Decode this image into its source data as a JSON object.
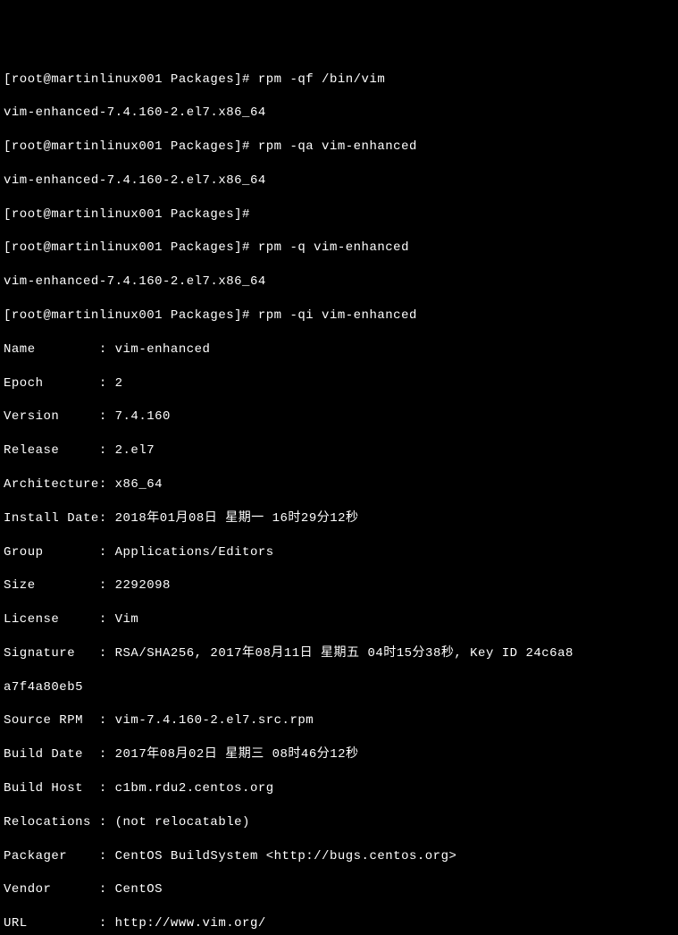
{
  "lines": {
    "l0_prompt": "[root@martinlinux001 Packages]# rpm -qf /bin/vim",
    "l1": "vim-enhanced-7.4.160-2.el7.x86_64",
    "l2_prompt": "[root@martinlinux001 Packages]# rpm -qa vim-enhanced",
    "l3": "vim-enhanced-7.4.160-2.el7.x86_64",
    "l4_prompt": "[root@martinlinux001 Packages]#",
    "l5_prompt": "[root@martinlinux001 Packages]# rpm -q vim-enhanced",
    "l6": "vim-enhanced-7.4.160-2.el7.x86_64",
    "l7_prompt": "[root@martinlinux001 Packages]# rpm -qi vim-enhanced",
    "f_name": "Name        : vim-enhanced",
    "f_epoch": "Epoch       : 2",
    "f_version": "Version     : 7.4.160",
    "f_release": "Release     : 2.el7",
    "f_arch": "Architecture: x86_64",
    "f_install": "Install Date: 2018年01月08日 星期一 16时29分12秒",
    "f_group": "Group       : Applications/Editors",
    "f_size": "Size        : 2292098",
    "f_license": "License     : Vim",
    "f_sig": "Signature   : RSA/SHA256, 2017年08月11日 星期五 04时15分38秒, Key ID 24c6a8",
    "f_sig2": "a7f4a80eb5",
    "f_srpm": "Source RPM  : vim-7.4.160-2.el7.src.rpm",
    "f_bdate": "Build Date  : 2017年08月02日 星期三 08时46分12秒",
    "f_bhost": "Build Host  : c1bm.rdu2.centos.org",
    "f_reloc": "Relocations : (not relocatable)",
    "f_packager": "Packager    : CentOS BuildSystem <http://bugs.centos.org>",
    "f_vendor": "Vendor      : CentOS",
    "f_url": "URL         : http://www.vim.org/"
  }
}
